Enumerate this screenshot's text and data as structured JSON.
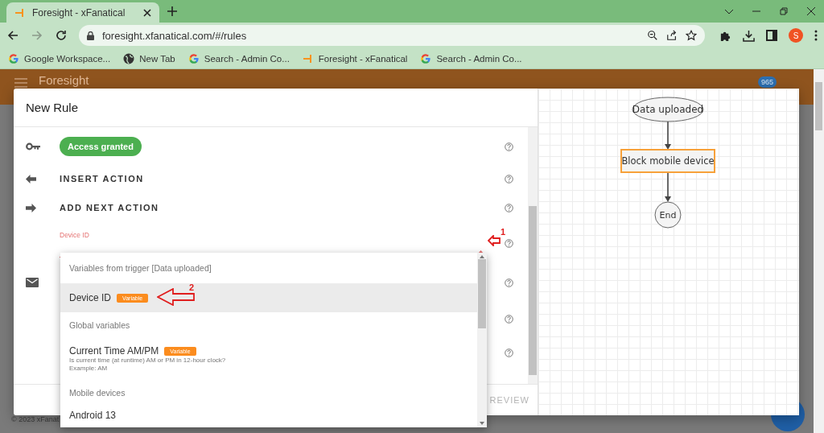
{
  "browser": {
    "tabs": [
      {
        "title": "Foresight - xFanatical",
        "selected": true
      }
    ],
    "url": "foresight.xfanatical.com/#/rules",
    "profile_initial": "S",
    "bookmarks": [
      {
        "kind": "google",
        "title": "Google Workspace..."
      },
      {
        "kind": "globe",
        "title": "New Tab"
      },
      {
        "kind": "google",
        "title": "Search - Admin Co..."
      },
      {
        "kind": "app",
        "title": "Foresight - xFanatical"
      },
      {
        "kind": "google",
        "title": "Search - Admin Co..."
      }
    ]
  },
  "app": {
    "title": "Foresight",
    "notification_count": "965",
    "footer": "© 2023 xFanat"
  },
  "dialog": {
    "title": "New Rule",
    "rows": [
      {
        "kind": "chip",
        "text": "Access granted"
      },
      {
        "kind": "insert",
        "text": "INSERT ACTION"
      },
      {
        "kind": "next",
        "text": "ADD NEXT ACTION"
      },
      {
        "kind": "field",
        "label": "Device ID",
        "expanded": true
      },
      {
        "kind": "email"
      },
      {
        "kind": "blank"
      },
      {
        "kind": "blank"
      }
    ],
    "footer_button": {
      "text": "REVIEW",
      "disabled": true
    }
  },
  "dropdown": {
    "items": [
      {
        "kind": "header",
        "text": "Variables from trigger [Data uploaded]"
      },
      {
        "kind": "option",
        "text": "Device ID",
        "badge": "Variable",
        "selected": true
      },
      {
        "kind": "header",
        "text": "Global variables"
      },
      {
        "kind": "option",
        "text": "Current Time AM/PM",
        "badge": "Variable",
        "description": [
          "Is current time (at runtime) AM or PM in 12-hour clock?",
          "Example: AM"
        ],
        "selected": false
      },
      {
        "kind": "header",
        "text": "Mobile devices"
      },
      {
        "kind": "option",
        "text": "Android 13",
        "selected": false
      }
    ]
  },
  "annotations": [
    {
      "text": "1"
    },
    {
      "text": "2"
    }
  ],
  "flowchart": {
    "nodes": [
      {
        "kind": "start",
        "text": "Data uploaded",
        "selected": false
      },
      {
        "kind": "action",
        "text": "Block mobile device",
        "selected": true
      },
      {
        "kind": "end",
        "text": "End",
        "selected": false
      }
    ]
  }
}
